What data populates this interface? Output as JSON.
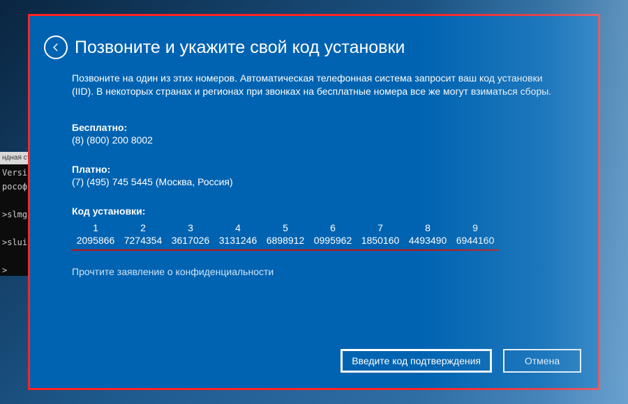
{
  "cmd": {
    "title": "ндная ст",
    "lines": "Versic\nрософт\n\n>slmgr\n\n>slui\n\n>"
  },
  "dialog": {
    "title": "Позвоните и укажите свой код установки",
    "body": "Позвоните на один из этих номеров. Автоматическая телефонная система запросит ваш код установки (IID). В некоторых странах и регионах при звонках на бесплатные номера все же могут взиматься сборы.",
    "tollfree_label": "Бесплатно:",
    "tollfree_value": "(8) (800) 200 8002",
    "toll_label": "Платно:",
    "toll_value": "(7) (495) 745 5445 (Москва, Россия)",
    "iid_label": "Код установки:",
    "iid_headers": [
      "1",
      "2",
      "3",
      "4",
      "5",
      "6",
      "7",
      "8",
      "9"
    ],
    "iid_values": [
      "2095866",
      "7274354",
      "3617026",
      "3131246",
      "6898912",
      "0995962",
      "1850160",
      "4493490",
      "6944160"
    ],
    "privacy": "Прочтите заявление о конфиденциальности",
    "confirm_btn": "Введите код подтверждения",
    "cancel_btn": "Отмена"
  }
}
